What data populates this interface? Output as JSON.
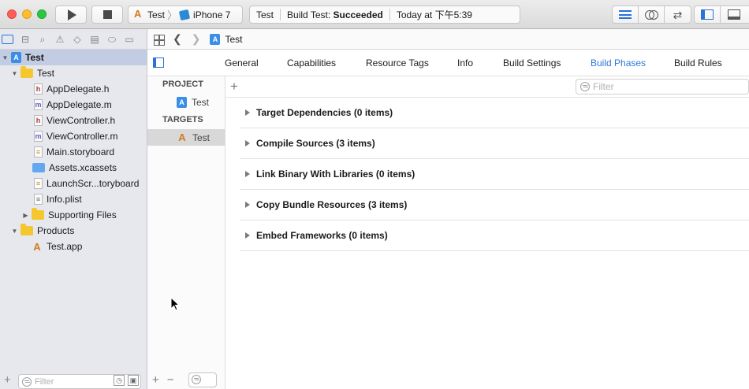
{
  "toolbar": {
    "scheme_target": "Test",
    "scheme_device": "iPhone 7",
    "status": {
      "project": "Test",
      "build_prefix": "Build Test: ",
      "build_result": "Succeeded",
      "time": "Today at 下午5:39"
    }
  },
  "navigator": {
    "filter_placeholder": "Filter",
    "items": [
      {
        "label": "Test",
        "icon": "project-icon"
      },
      {
        "label": "Test",
        "icon": "folder-icon"
      },
      {
        "label": "AppDelegate.h",
        "icon": "header-file-icon"
      },
      {
        "label": "AppDelegate.m",
        "icon": "source-file-icon"
      },
      {
        "label": "ViewController.h",
        "icon": "header-file-icon"
      },
      {
        "label": "ViewController.m",
        "icon": "source-file-icon"
      },
      {
        "label": "Main.storyboard",
        "icon": "storyboard-file-icon"
      },
      {
        "label": "Assets.xcassets",
        "icon": "assets-folder-icon"
      },
      {
        "label": "LaunchScr...toryboard",
        "icon": "storyboard-file-icon"
      },
      {
        "label": "Info.plist",
        "icon": "plist-file-icon"
      },
      {
        "label": "Supporting Files",
        "icon": "folder-icon"
      },
      {
        "label": "Products",
        "icon": "folder-icon"
      },
      {
        "label": "Test.app",
        "icon": "app-target-icon"
      }
    ]
  },
  "jumpbar": {
    "crumb": "Test"
  },
  "tabs": [
    {
      "label": "General"
    },
    {
      "label": "Capabilities"
    },
    {
      "label": "Resource Tags"
    },
    {
      "label": "Info"
    },
    {
      "label": "Build Settings"
    },
    {
      "label": "Build Phases",
      "active": true
    },
    {
      "label": "Build Rules"
    }
  ],
  "targets_pane": {
    "project_header": "PROJECT",
    "project_item": "Test",
    "targets_header": "TARGETS",
    "target_item": "Test"
  },
  "phases": {
    "filter_placeholder": "Filter",
    "rows": [
      {
        "label": "Target Dependencies (0 items)"
      },
      {
        "label": "Compile Sources (3 items)"
      },
      {
        "label": "Link Binary With Libraries (0 items)"
      },
      {
        "label": "Copy Bundle Resources (3 items)"
      },
      {
        "label": "Embed Frameworks (0 items)"
      }
    ]
  },
  "colors": {
    "accent": "#2f78d9",
    "selection": "#c2cde3"
  }
}
